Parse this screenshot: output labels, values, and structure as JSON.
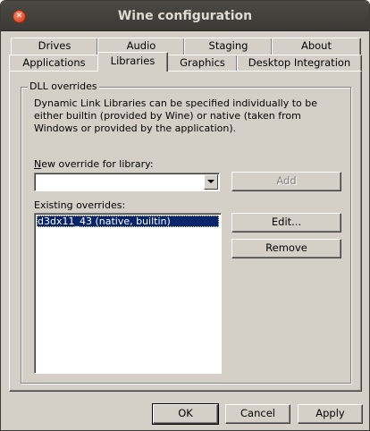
{
  "window": {
    "title": "Wine configuration"
  },
  "tabs_row1": [
    "Drives",
    "Audio",
    "Staging",
    "About"
  ],
  "tabs_row2": [
    "Applications",
    "Libraries",
    "Graphics",
    "Desktop Integration"
  ],
  "active_tab": "Libraries",
  "group": {
    "legend": "DLL overrides",
    "description": "Dynamic Link Libraries can be specified individually to be either builtin (provided by Wine) or native (taken from Windows or provided by the application)."
  },
  "new_override": {
    "label": "New override for library:",
    "value": ""
  },
  "add_button": "Add",
  "existing": {
    "label": "Existing overrides:",
    "items": [
      "d3dx11_43 (native, builtin)"
    ],
    "selected_index": 0
  },
  "edit_button": "Edit...",
  "remove_button": "Remove",
  "footer": {
    "ok": "OK",
    "cancel": "Cancel",
    "apply": "Apply"
  }
}
